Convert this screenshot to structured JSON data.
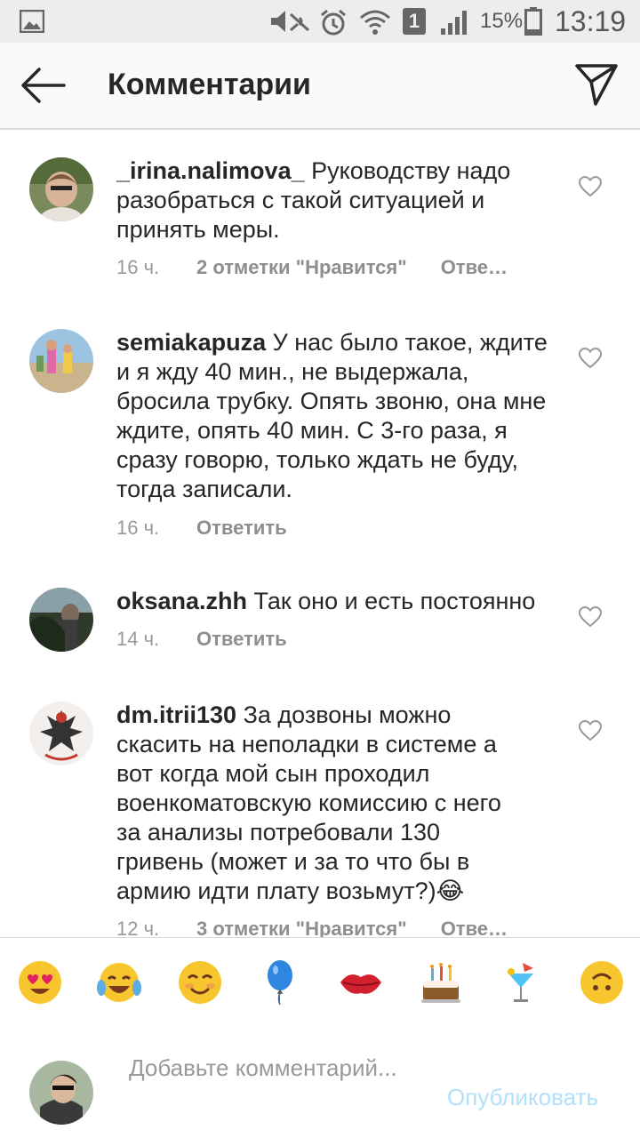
{
  "status_bar": {
    "battery": "15%",
    "time": "13:19",
    "sim_badge": "1",
    "icons": [
      "gallery-icon",
      "mute-icon",
      "alarm-icon",
      "wifi-icon",
      "sim-icon",
      "signal-icon",
      "battery-icon"
    ]
  },
  "header": {
    "title": "Комментарии",
    "back_icon": "arrow-left-icon",
    "send_icon": "paper-plane-icon"
  },
  "comments": [
    {
      "username": "_irina.nalimova_",
      "text": " Руководству надо разобраться с такой ситуацией и принять меры.",
      "time": "16 ч.",
      "likes": "2 отметки \"Нравится\"",
      "reply": "Отве…"
    },
    {
      "username": "semiakapuza",
      "text": " У нас было такое, ждите и я жду  40 мин., не выдержала, бросила трубку. Опять звоню,  она мне ждите, опять 40 мин. С 3-го раза, я сразу говорю, только ждать не буду, тогда записали.",
      "time": "16 ч.",
      "likes": "",
      "reply": "Ответить"
    },
    {
      "username": "oksana.zhh",
      "text": " Так оно и есть постоянно",
      "time": "14 ч.",
      "likes": "",
      "reply": "Ответить"
    },
    {
      "username": "dm.itrii130",
      "text": " За дозвоны можно скасить на неполадки в системе а вот когда мой сын проходил военкоматовскую комиссию с него за анализы потребовали 130 гривень (может и за то что бы в армию идти плату возьмут?)😂",
      "time": "12 ч.",
      "likes": "3 отметки \"Нравится\"",
      "reply": "Отве…"
    }
  ],
  "emoji_bar": [
    {
      "name": "heart-eyes-emoji",
      "char": "😍"
    },
    {
      "name": "tears-of-joy-emoji",
      "char": "😂"
    },
    {
      "name": "smiling-emoji",
      "char": "😊"
    },
    {
      "name": "balloon-emoji",
      "char": "🎈"
    },
    {
      "name": "kiss-lips-emoji",
      "char": "💋"
    },
    {
      "name": "birthday-cake-emoji",
      "char": "🎂"
    },
    {
      "name": "cocktail-emoji",
      "char": "🍹"
    },
    {
      "name": "upside-down-face-emoji",
      "char": "🙃"
    }
  ],
  "composer": {
    "placeholder": "Добавьте комментарий...",
    "post_label": "Опубликовать"
  },
  "colors": {
    "text": "#262626",
    "meta": "#999999",
    "post_disabled": "#b2dffc",
    "status_bar_bg": "#ededed",
    "header_bg": "#fafafa"
  }
}
